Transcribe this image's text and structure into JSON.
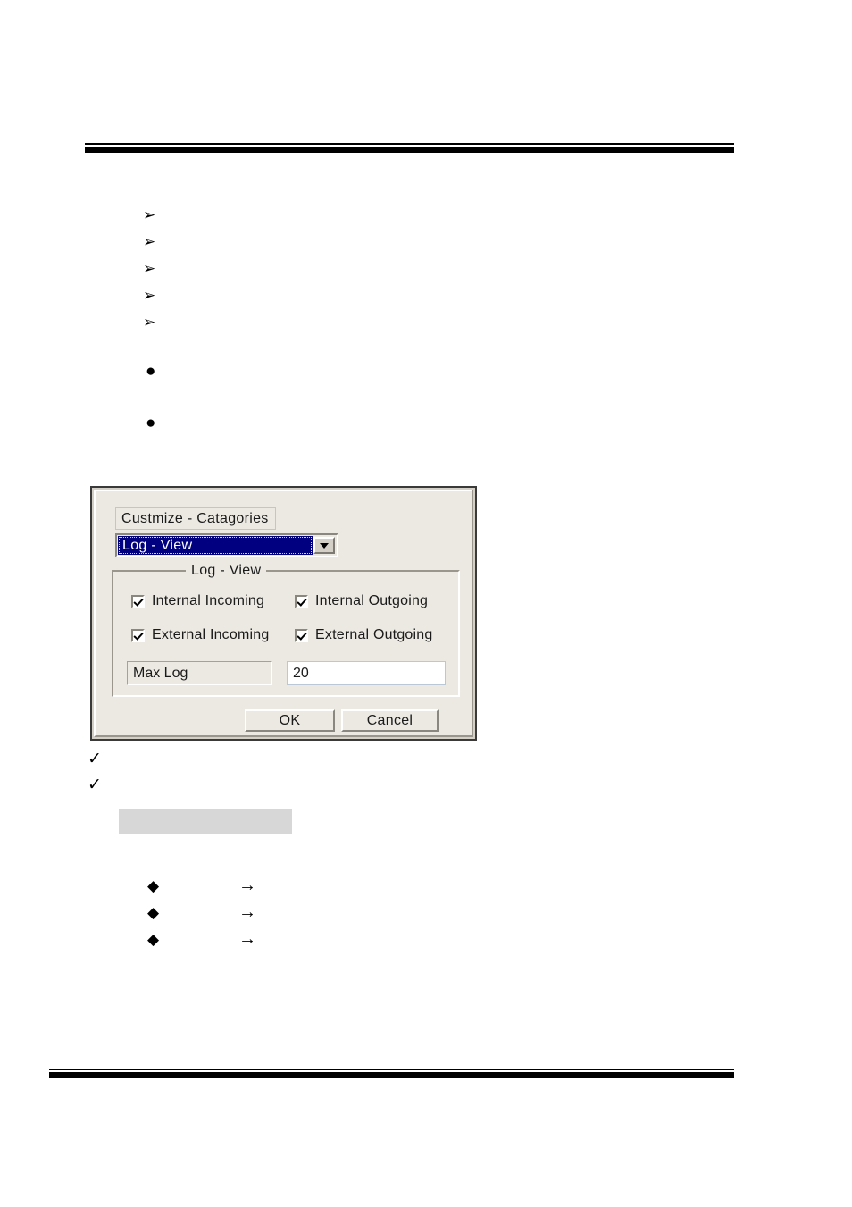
{
  "page": {
    "header_rule": "double-rule",
    "footer_rule": "double-rule"
  },
  "lists": {
    "arrowhead_bullets": [
      {
        "glyph": "➢",
        "icon": "arrowhead-bullet-icon",
        "text": ""
      },
      {
        "glyph": "➢",
        "icon": "arrowhead-bullet-icon",
        "text": ""
      },
      {
        "glyph": "➢",
        "icon": "arrowhead-bullet-icon",
        "text": ""
      },
      {
        "glyph": "➢",
        "icon": "arrowhead-bullet-icon",
        "text": ""
      },
      {
        "glyph": "➢",
        "icon": "arrowhead-bullet-icon",
        "text": ""
      }
    ],
    "disc_bullets": [
      {
        "glyph": "●",
        "icon": "disc-bullet-icon",
        "text": ""
      },
      {
        "glyph": "●",
        "icon": "disc-bullet-icon",
        "text": ""
      }
    ],
    "check_bullets": [
      {
        "glyph": "✓",
        "icon": "check-bullet-icon",
        "text": ""
      },
      {
        "glyph": "✓",
        "icon": "check-bullet-icon",
        "text": ""
      }
    ],
    "diamond_bullets": [
      {
        "glyph": "◆",
        "icon": "diamond-bullet-icon",
        "text": "",
        "arrow": "→"
      },
      {
        "glyph": "◆",
        "icon": "diamond-bullet-icon",
        "text": "",
        "arrow": "→"
      },
      {
        "glyph": "◆",
        "icon": "diamond-bullet-icon",
        "text": "",
        "arrow": "→"
      }
    ]
  },
  "highlight_box": {
    "text": "",
    "color": "#d7d7d7"
  },
  "dialog": {
    "title": "Custmize - Catagories",
    "category": {
      "selected": "Log - View",
      "options": [
        "Log - View"
      ],
      "caret_icon": "chevron-down-icon",
      "selection_color": "#000080"
    },
    "group": {
      "legend": "Log - View",
      "checkboxes": [
        {
          "label": "Internal Incoming",
          "checked": true
        },
        {
          "label": "Internal Outgoing",
          "checked": true
        },
        {
          "label": "External Incoming",
          "checked": true
        },
        {
          "label": "External Outgoing",
          "checked": true
        }
      ],
      "max_log": {
        "label": "Max Log",
        "value": "20"
      }
    },
    "buttons": {
      "ok": "OK",
      "cancel": "Cancel"
    }
  }
}
